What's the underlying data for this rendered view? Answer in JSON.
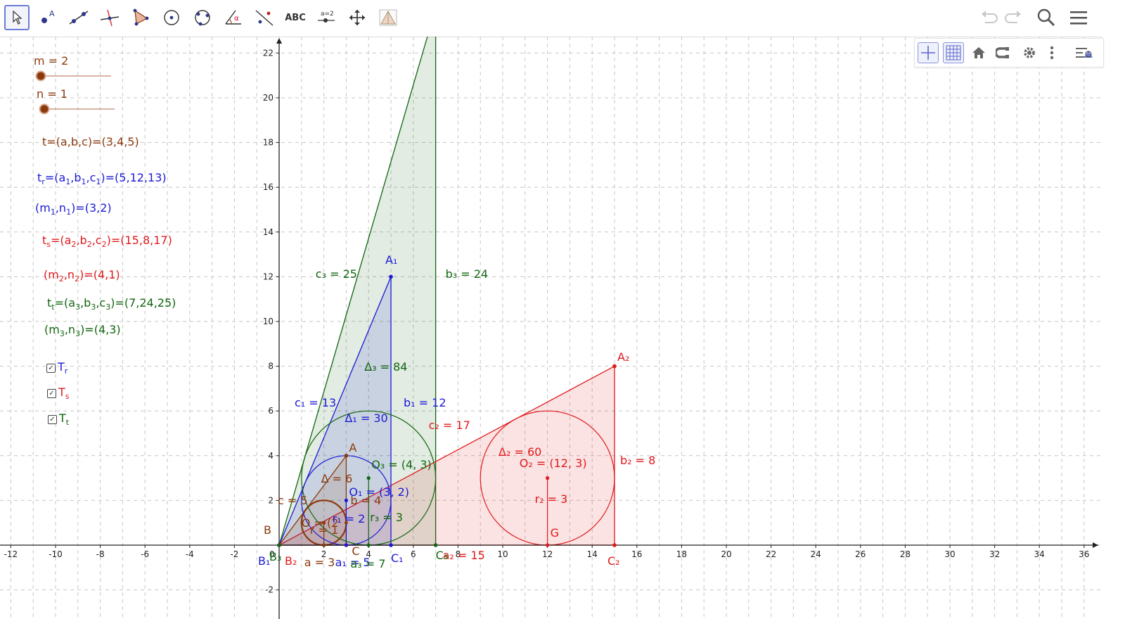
{
  "toolbar": {
    "tools": [
      {
        "name": "move-tool",
        "label": "",
        "selected": true
      },
      {
        "name": "point-tool",
        "label": "A"
      },
      {
        "name": "line-tool",
        "label": ""
      },
      {
        "name": "perpendicular-line-tool",
        "label": ""
      },
      {
        "name": "polygon-tool",
        "label": ""
      },
      {
        "name": "circle-center-point-tool",
        "label": ""
      },
      {
        "name": "conic-tool",
        "label": ""
      },
      {
        "name": "angle-tool",
        "label": "α"
      },
      {
        "name": "reflect-tool",
        "label": ""
      },
      {
        "name": "text-tool",
        "label": "ABC"
      },
      {
        "name": "slider-tool",
        "label": "a=2"
      },
      {
        "name": "move-graphics-view-tool",
        "label": ""
      },
      {
        "name": "custom-tool",
        "label": ""
      }
    ],
    "right_icons": [
      "undo-icon",
      "redo-icon",
      "search-icon",
      "menu-icon"
    ]
  },
  "graphics_style_bar": [
    "axes-toggle-icon",
    "grid-toggle-icon",
    "home-icon",
    "point-capture-icon",
    "settings-icon",
    "more-icon",
    "style-bar-toggle-icon"
  ],
  "colors": {
    "brown": "#8b3a0e",
    "blue": "#1a1ad6",
    "red": "#e0191c",
    "green": "#11660f",
    "axis": "#222222",
    "grid": "#c6c6c6"
  },
  "algebra_panel": {
    "slider_m": {
      "label": "m = 2",
      "value": 2
    },
    "slider_n": {
      "label": "n = 1",
      "value": 1
    },
    "t_text": "t=(a,b,c)=(3,4,5)",
    "tr_pre": "t",
    "tr_sub": "r",
    "tr_eq": "=(a",
    "a1_sub": "1",
    "tr_b": ",b",
    "b1_sub": "1",
    "tr_c": ",c",
    "c1_sub": "1",
    "tr_end": ")=(5,12,13)",
    "m1n1_pre": "(m",
    "m1_sub": "1",
    "m1n1_mid": ",n",
    "n1_sub": "1",
    "m1n1_end": ")=(3,2)",
    "ts_pre": "t",
    "ts_sub": "s",
    "ts_eq": "=(a",
    "a2_sub": "2",
    "ts_b": ",b",
    "b2_sub": "2",
    "ts_c": ",c",
    "c2_sub": "2",
    "ts_end": ")=(15,8,17)",
    "m2n2_pre": "(m",
    "m2_sub": "2",
    "m2n2_mid": ",n",
    "n2_sub": "2",
    "m2n2_end": ")=(4,1)",
    "tt_pre": "t",
    "tt_sub": "t",
    "tt_eq": "=(a",
    "a3_sub": "3",
    "tt_b": ",b",
    "b3_sub": "3",
    "tt_c": ",c",
    "c3_sub": "3",
    "tt_end": ")=(7,24,25)",
    "m3n3_pre": "(m",
    "m3_sub": "3",
    "m3n3_mid": ",n",
    "n3_sub": "3",
    "m3n3_end": ")=(4,3)",
    "checkboxes": [
      {
        "main": "T",
        "sub": "r",
        "checked": true,
        "color": "#1a1ad6"
      },
      {
        "main": "T",
        "sub": "s",
        "checked": true,
        "color": "#e0191c"
      },
      {
        "main": "T",
        "sub": "t",
        "checked": true,
        "color": "#11660f"
      }
    ]
  },
  "axes": {
    "x_ticks": [
      -12,
      -10,
      -8,
      -6,
      -4,
      -2,
      2,
      4,
      6,
      8,
      10,
      12,
      14,
      16,
      18,
      20,
      22,
      24,
      26,
      28,
      30,
      32,
      34,
      36
    ],
    "y_ticks": [
      -2,
      2,
      4,
      6,
      8,
      10,
      12,
      14,
      16,
      18,
      20,
      22
    ],
    "origin_label": "0"
  },
  "chart_data": {
    "type": "geometry",
    "triangles": [
      {
        "name": "t",
        "color": "#8b3a0e",
        "vertices": [
          [
            0,
            0
          ],
          [
            3,
            0
          ],
          [
            3,
            4
          ]
        ],
        "incircle": {
          "center": [
            2,
            1
          ],
          "r": 1
        }
      },
      {
        "name": "t_r",
        "color": "#1a1ad6",
        "vertices": [
          [
            0,
            0
          ],
          [
            5,
            0
          ],
          [
            5,
            12
          ]
        ],
        "incircle": {
          "center": [
            3,
            2
          ],
          "r": 2
        }
      },
      {
        "name": "t_s",
        "color": "#e0191c",
        "vertices": [
          [
            0,
            0
          ],
          [
            15,
            0
          ],
          [
            15,
            8
          ]
        ],
        "incircle": {
          "center": [
            12,
            3
          ],
          "r": 3
        }
      },
      {
        "name": "t_t",
        "color": "#11660f",
        "vertices": [
          [
            0,
            0
          ],
          [
            7,
            0
          ],
          [
            7,
            24
          ]
        ],
        "incircle": {
          "center": [
            4,
            3
          ],
          "r": 3
        }
      }
    ],
    "extra_circles": [
      {
        "center": [
          4,
          3
        ],
        "r": 3,
        "color": "#11660f"
      },
      {
        "center": [
          3,
          2
        ],
        "r": 2,
        "color": "#1a1ad6"
      }
    ],
    "x_range": [
      -12,
      36
    ],
    "y_range": [
      -2,
      22
    ],
    "grid": true
  },
  "canvas_labels": [
    {
      "id": "lbl-A",
      "x": 3,
      "y": 4,
      "dx": 4,
      "dy": -20,
      "text": "A",
      "color": "#8b3a0e"
    },
    {
      "id": "lbl-B",
      "x": 0,
      "y": 0,
      "dx": -22,
      "dy": -30,
      "text": "B",
      "color": "#8b3a0e"
    },
    {
      "id": "lbl-C",
      "x": 3,
      "y": 0,
      "dx": 8,
      "dy": 0,
      "text": "C",
      "color": "#8b3a0e"
    },
    {
      "id": "lbl-c",
      "x": 0,
      "y": 0,
      "dx": -2,
      "dy": -72,
      "text": "c = 5",
      "color": "#8b3a0e"
    },
    {
      "id": "lbl-delta",
      "x": 2,
      "y": 3,
      "dx": -4,
      "dy": -8,
      "text": "Δ = 6",
      "color": "#8b3a0e"
    },
    {
      "id": "lbl-b",
      "x": 3,
      "y": 2,
      "dx": 6,
      "dy": -8,
      "text": "b = 4",
      "color": "#8b3a0e"
    },
    {
      "id": "lbl-O",
      "x": 1,
      "y": 1,
      "dx": 0,
      "dy": -8,
      "text": "O = (2",
      "color": "#8b3a0e"
    },
    {
      "id": "lbl-r",
      "x": 1,
      "y": 0,
      "dx": 12,
      "dy": -30,
      "text": "r = 1",
      "color": "#8b3a0e"
    },
    {
      "id": "lbl-a",
      "x": 1,
      "y": 0,
      "dx": 4,
      "dy": 16,
      "text": "a = 3",
      "color": "#8b3a0e"
    },
    {
      "id": "lbl-A1",
      "x": 5,
      "y": 12,
      "dx": -8,
      "dy": -32,
      "text": "A₁",
      "color": "#1a1ad6"
    },
    {
      "id": "lbl-b1",
      "x": 5,
      "y": 6,
      "dx": 18,
      "dy": -20,
      "text": "b₁ = 12",
      "color": "#1a1ad6"
    },
    {
      "id": "lbl-c1",
      "x": 0,
      "y": 6,
      "dx": 22,
      "dy": -20,
      "text": "c₁ = 13",
      "color": "#1a1ad6"
    },
    {
      "id": "lbl-D1",
      "x": 3,
      "y": 6,
      "dx": -2,
      "dy": 2,
      "text": "Δ₁ = 30",
      "color": "#1a1ad6"
    },
    {
      "id": "lbl-O1",
      "x": 3,
      "y": 2,
      "dx": 4,
      "dy": -20,
      "text": "O₁ = (3, 2)",
      "color": "#1a1ad6"
    },
    {
      "id": "lbl-r1",
      "x": 2,
      "y": 1,
      "dx": 12,
      "dy": -14,
      "text": "r₁ = 2",
      "color": "#1a1ad6"
    },
    {
      "id": "lbl-C1",
      "x": 5,
      "y": 0,
      "dx": 0,
      "dy": 10,
      "text": "C₁",
      "color": "#1a1ad6"
    },
    {
      "id": "lbl-a1",
      "x": 2,
      "y": 0,
      "dx": 16,
      "dy": 16,
      "text": "a₁ = 5",
      "color": "#1a1ad6"
    },
    {
      "id": "lbl-B1",
      "x": 0,
      "y": 0,
      "dx": -30,
      "dy": 14,
      "text": "B₁",
      "color": "#1a1ad6"
    },
    {
      "id": "lbl-A2",
      "x": 15,
      "y": 8,
      "dx": 4,
      "dy": -22,
      "text": "A₂",
      "color": "#e0191c"
    },
    {
      "id": "lbl-b2",
      "x": 15,
      "y": 4,
      "dx": 8,
      "dy": -2,
      "text": "b₂ = 8",
      "color": "#e0191c"
    },
    {
      "id": "lbl-c2",
      "x": 7,
      "y": 5,
      "dx": -10,
      "dy": -20,
      "text": "c₂ = 17",
      "color": "#e0191c"
    },
    {
      "id": "lbl-D2",
      "x": 10,
      "y": 4,
      "dx": -6,
      "dy": -14,
      "text": "Δ₂ = 60",
      "color": "#e0191c"
    },
    {
      "id": "lbl-O2",
      "x": 11,
      "y": 3,
      "dx": -8,
      "dy": -30,
      "text": "O₂ = (12, 3)",
      "color": "#e0191c"
    },
    {
      "id": "lbl-r2",
      "x": 12,
      "y": 2,
      "dx": -18,
      "dy": -10,
      "text": "r₂ = 3",
      "color": "#e0191c"
    },
    {
      "id": "lbl-G",
      "x": 12,
      "y": 0,
      "dx": 4,
      "dy": -26,
      "text": "G",
      "color": "#e0191c"
    },
    {
      "id": "lbl-C2",
      "x": 15,
      "y": 0,
      "dx": -10,
      "dy": 14,
      "text": "C₂",
      "color": "#e0191c"
    },
    {
      "id": "lbl-a2",
      "x": 7,
      "y": 0,
      "dx": 10,
      "dy": 6,
      "text": "a₂ = 15",
      "color": "#e0191c"
    },
    {
      "id": "lbl-B2",
      "x": 0,
      "y": 0,
      "dx": 8,
      "dy": 14,
      "text": "B₂",
      "color": "#e0191c"
    },
    {
      "id": "lbl-c3",
      "x": 1,
      "y": 12,
      "dx": 20,
      "dy": -12,
      "text": "c₃ = 25",
      "color": "#11660f"
    },
    {
      "id": "lbl-b3",
      "x": 7,
      "y": 12,
      "dx": 14,
      "dy": -12,
      "text": "b₃ = 24",
      "color": "#11660f"
    },
    {
      "id": "lbl-D3",
      "x": 4,
      "y": 8,
      "dx": -6,
      "dy": -8,
      "text": "Δ₃ = 84",
      "color": "#11660f"
    },
    {
      "id": "lbl-O3",
      "x": 4,
      "y": 3,
      "dx": 4,
      "dy": -28,
      "text": "O₃ = (4, 3)",
      "color": "#11660f"
    },
    {
      "id": "lbl-r3",
      "x": 4,
      "y": 1,
      "dx": 2,
      "dy": -16,
      "text": "r₃ = 3",
      "color": "#11660f"
    },
    {
      "id": "lbl-C3",
      "x": 7,
      "y": 0,
      "dx": 0,
      "dy": 6,
      "text": "C₃",
      "color": "#11660f"
    },
    {
      "id": "lbl-a3",
      "x": 3,
      "y": 0,
      "dx": 6,
      "dy": 18,
      "text": "a₃ = 7",
      "color": "#11660f"
    },
    {
      "id": "lbl-B3",
      "x": 0,
      "y": 0,
      "dx": -14,
      "dy": 8,
      "text": "B₃",
      "color": "#11660f"
    }
  ]
}
